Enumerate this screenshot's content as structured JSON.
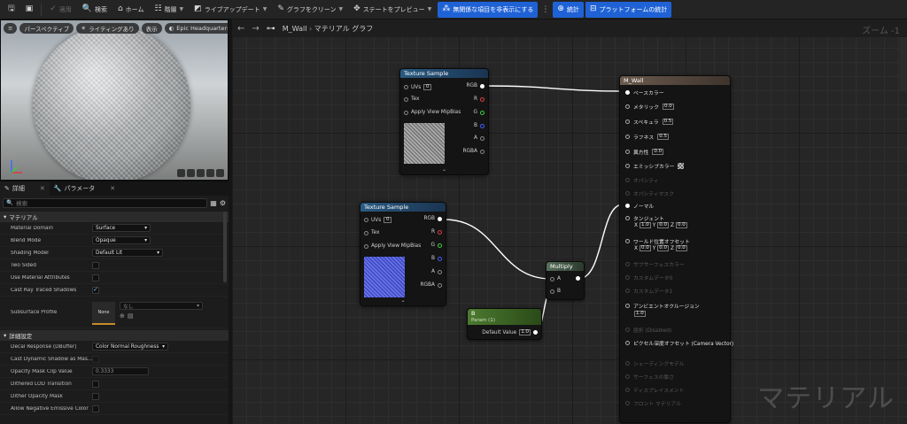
{
  "toolbar": {
    "apply": "適用",
    "search": "検索",
    "home": "ホーム",
    "hierarchy": "階層",
    "live_update": "ライブアップデート",
    "clean_graph": "グラフをクリーン",
    "preview_state": "ステートをプレビュー",
    "hide_unrelated": "無関係な項目を非表示にする",
    "stats": "統計",
    "platform_stats": "プラットフォームの統計"
  },
  "viewport": {
    "perspective": "パースペクティブ",
    "lit": "ライティングあり",
    "show": "表示",
    "env": "Epic Headquarters"
  },
  "details": {
    "tab_details": "詳細",
    "tab_params": "パラメータ",
    "search_placeholder": "検索",
    "section_material": "マテリアル",
    "section_advanced": "詳細設定",
    "rows": {
      "material_domain": {
        "label": "Material Domain",
        "value": "Surface"
      },
      "blend_mode": {
        "label": "Blend Mode",
        "value": "Opaque"
      },
      "shading_model": {
        "label": "Shading Model",
        "value": "Default Lit"
      },
      "two_sided": {
        "label": "Two Sided"
      },
      "use_material_attributes": {
        "label": "Use Material Attributes"
      },
      "cast_ray_traced": {
        "label": "Cast Ray Traced Shadows"
      },
      "subsurface_profile": {
        "label": "Subsurface Profile",
        "thumb": "None",
        "value": "なし"
      },
      "decal_response": {
        "label": "Decal Response (DBuffer)",
        "value": "Color Normal Roughness"
      },
      "cast_dynamic_shadow": {
        "label": "Cast Dynamic Shadow as Mas..."
      },
      "opacity_mask_clip": {
        "label": "Opacity Mask Clip Value",
        "value": "0.3333"
      },
      "dithered_lod": {
        "label": "Dithered LOD Transition"
      },
      "dither_opacity": {
        "label": "Dither Opacity Mask"
      },
      "allow_negative_emissive": {
        "label": "Allow Negative Emissive Color"
      }
    }
  },
  "graph": {
    "breadcrumb_asset": "M_Wall",
    "breadcrumb_page": "マテリアル グラフ",
    "zoom": "ズーム -1",
    "watermark": "マテリアル"
  },
  "nodes": {
    "tex1": {
      "title": "Texture Sample",
      "uvs": "UVs",
      "uvs_val": "0",
      "tex": "Tex",
      "mip": "Apply View MipBias",
      "rgb": "RGB",
      "r": "R",
      "g": "G",
      "b": "B",
      "a": "A",
      "rgba": "RGBA"
    },
    "tex2": {
      "title": "Texture Sample",
      "uvs": "UVs",
      "uvs_val": "0",
      "tex": "Tex",
      "mip": "Apply View MipBias",
      "rgb": "RGB",
      "r": "R",
      "g": "G",
      "b": "B",
      "a": "A",
      "rgba": "RGBA"
    },
    "multiply": {
      "title": "Multiply",
      "a": "A",
      "b": "B"
    },
    "param": {
      "title": "B",
      "subtitle": "Param (1)",
      "label": "Default Value",
      "value": "1.0"
    },
    "result": {
      "title": "M_Wall",
      "base_color": "ベースカラー",
      "metallic": "メタリック",
      "metallic_val": "0.0",
      "specular": "スペキュラ",
      "specular_val": "0.5",
      "roughness": "ラフネス",
      "roughness_val": "0.5",
      "anisotropy": "異方性",
      "anisotropy_val": "0.0",
      "emissive": "エミッシブカラー",
      "opacity": "オパシティ",
      "opacity_mask": "オパシティマスク",
      "normal": "ノーマル",
      "tangent": "タンジェント",
      "tx": "X",
      "tx_val": "1.0",
      "ty": "Y",
      "ty_val": "0.0",
      "tz": "Z",
      "tz_val": "0.0",
      "wpo": "ワールド位置オフセット",
      "wx": "X",
      "wx_val": "0.0",
      "wy": "Y",
      "wy_val": "0.0",
      "wz": "Z",
      "wz_val": "0.0",
      "subsurface": "サブサーフェスカラー",
      "custom0": "カスタムデータ0",
      "custom1": "カスタムデータ1",
      "ao": "アンビエントオクルージョン",
      "ao_val": "1.0",
      "refraction": "屈折 (Disabled)",
      "pdo": "ピクセル深度オフセット (Camera Vector)",
      "shading_model": "シェーディングモデル",
      "surface_thickness": "サーフェスの厚さ",
      "displacement": "ディスプレイスメント",
      "front_material": "フロント マテリアル"
    }
  },
  "colors": {
    "accent": "#1f62d6",
    "pin_red": "#e04040",
    "pin_green": "#40d040",
    "pin_blue": "#4060ff"
  }
}
